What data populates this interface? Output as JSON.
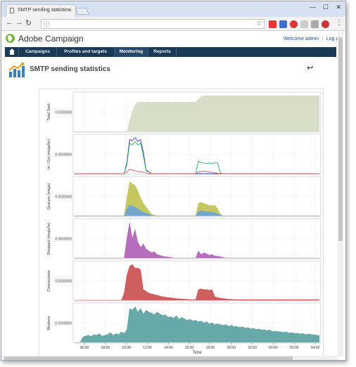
{
  "browser": {
    "tab_title": "SMTP sending statistics",
    "tab_close": "×",
    "win_minimize": "—",
    "win_maximize": "☐",
    "win_close": "✕"
  },
  "header": {
    "app_title": "Adobe Campaign",
    "welcome": "Welcome admin",
    "separator": "|",
    "logoff": "Log off"
  },
  "menu": {
    "items": [
      {
        "label": "Campaigns"
      },
      {
        "label": "Profiles and targets"
      },
      {
        "label": "Monitoring"
      },
      {
        "label": "Reports"
      }
    ]
  },
  "page": {
    "title": "SMTP sending statistics",
    "back_icon": "↩"
  },
  "chart_data": {
    "type": "area",
    "xlabel": "Time",
    "x_ticks": [
      "06:00",
      "08:00",
      "10:00",
      "12:00",
      "14:00",
      "16:00",
      "18:00",
      "20:00",
      "22:00",
      "00:00",
      "02:00",
      "04:00"
    ],
    "panels": [
      {
        "name": "Total Sent",
        "ytick": "0.0000000",
        "series": [
          {
            "color": "#d5dcc4",
            "values": [
              0,
              0,
              0,
              0,
              0,
              0,
              0,
              0,
              0,
              0,
              0,
              0,
              0,
              0,
              0,
              0,
              0,
              0,
              0,
              0,
              0.3,
              0.55,
              0.75,
              0.82,
              0.82,
              0.82,
              0.82,
              0.82,
              0.82,
              0.82,
              0.82,
              0.82,
              0.82,
              0.82,
              0.82,
              0.82,
              0.82,
              0.82,
              0.82,
              0.82,
              0.82,
              0.82,
              0.82,
              0.82,
              0.82,
              0.9,
              0.97,
              1,
              1,
              1,
              1,
              1,
              1,
              1,
              1,
              1,
              1,
              1,
              1,
              1,
              1,
              1,
              1,
              1,
              1,
              1,
              1,
              1,
              1,
              1,
              1,
              1,
              1,
              1,
              1,
              1,
              1,
              1,
              1,
              1,
              1,
              1,
              1,
              1,
              1,
              1,
              1,
              1,
              1,
              1
            ]
          }
        ]
      },
      {
        "name": "In / Out (msgs/hr)",
        "ytick": "0.0000000",
        "series": [
          {
            "color": "#3b3bd6",
            "values": [
              0,
              0,
              0,
              0,
              0,
              0,
              0,
              0,
              0,
              0,
              0,
              0,
              0,
              0,
              0,
              0,
              0,
              0,
              0,
              0.3,
              0.95,
              0.92,
              1,
              0.9,
              0.95,
              0.6,
              0.1,
              0.05,
              0,
              0,
              0,
              0,
              0,
              0,
              0,
              0,
              0,
              0,
              0,
              0,
              0,
              0,
              0,
              0,
              0,
              0,
              0,
              0,
              0,
              0,
              0,
              0,
              0,
              0,
              0,
              0,
              0,
              0,
              0,
              0,
              0,
              0,
              0,
              0,
              0,
              0,
              0,
              0,
              0,
              0,
              0,
              0,
              0,
              0,
              0,
              0,
              0,
              0,
              0,
              0,
              0,
              0,
              0,
              0,
              0,
              0,
              0,
              0,
              0,
              0
            ]
          },
          {
            "color": "#27b35a",
            "values": [
              0,
              0,
              0,
              0,
              0,
              0,
              0,
              0,
              0,
              0,
              0,
              0,
              0,
              0,
              0,
              0,
              0,
              0,
              0,
              0.25,
              0.85,
              0.8,
              0.9,
              0.8,
              0.85,
              0.5,
              0.08,
              0.04,
              0,
              0,
              0,
              0,
              0,
              0,
              0,
              0,
              0,
              0,
              0,
              0,
              0,
              0,
              0,
              0,
              0,
              0.35,
              0.3,
              0.3,
              0.28,
              0.3,
              0.28,
              0.3,
              0.3,
              0.02,
              0,
              0,
              0,
              0,
              0,
              0,
              0,
              0,
              0,
              0,
              0,
              0,
              0,
              0,
              0,
              0,
              0,
              0,
              0,
              0,
              0,
              0,
              0,
              0,
              0,
              0,
              0,
              0,
              0,
              0,
              0,
              0,
              0,
              0,
              0,
              0
            ]
          },
          {
            "color": "#e05a5a",
            "values": [
              0,
              0,
              0,
              0,
              0,
              0,
              0,
              0,
              0,
              0,
              0,
              0,
              0,
              0,
              0,
              0,
              0,
              0,
              0,
              0.05,
              0.12,
              0.1,
              0.08,
              0.06,
              0.05,
              0.04,
              0.02,
              0,
              0,
              0,
              0,
              0,
              0,
              0,
              0,
              0,
              0,
              0,
              0,
              0,
              0,
              0,
              0,
              0,
              0,
              0.05,
              0.06,
              0.07,
              0.06,
              0.05,
              0.03,
              0.02,
              0.01,
              0,
              0,
              0,
              0,
              0,
              0,
              0,
              0,
              0,
              0,
              0,
              0,
              0,
              0,
              0,
              0,
              0,
              0,
              0,
              0,
              0,
              0,
              0,
              0,
              0,
              0,
              0,
              0,
              0,
              0,
              0,
              0,
              0,
              0,
              0,
              0,
              0
            ]
          }
        ]
      },
      {
        "name": "Queues (msgs)",
        "ytick": "0.0000000",
        "series": [
          {
            "color": "#c4c45a",
            "values": [
              0,
              0,
              0,
              0,
              0,
              0,
              0,
              0,
              0,
              0,
              0,
              0,
              0,
              0,
              0,
              0,
              0,
              0,
              0,
              0.5,
              0.95,
              0.9,
              0.85,
              0.7,
              0.5,
              0.35,
              0.25,
              0.15,
              0.05,
              0.02,
              0,
              0,
              0,
              0,
              0,
              0,
              0,
              0,
              0,
              0,
              0,
              0,
              0,
              0,
              0,
              0.35,
              0.38,
              0.35,
              0.32,
              0.3,
              0.28,
              0.3,
              0.2,
              0.05,
              0,
              0,
              0,
              0,
              0,
              0,
              0,
              0,
              0,
              0,
              0,
              0,
              0,
              0,
              0,
              0,
              0,
              0,
              0,
              0,
              0,
              0,
              0,
              0,
              0,
              0,
              0,
              0,
              0,
              0,
              0,
              0,
              0,
              0,
              0,
              0
            ]
          },
          {
            "color": "#6fa7d0",
            "values": [
              0,
              0,
              0,
              0,
              0,
              0,
              0,
              0,
              0,
              0,
              0,
              0,
              0,
              0,
              0,
              0,
              0,
              0,
              0,
              0.2,
              0.3,
              0.28,
              0.25,
              0.2,
              0.15,
              0.1,
              0.08,
              0.05,
              0.02,
              0,
              0,
              0,
              0,
              0,
              0,
              0,
              0,
              0,
              0,
              0,
              0,
              0,
              0,
              0,
              0,
              0.12,
              0.14,
              0.13,
              0.12,
              0.12,
              0.1,
              0.1,
              0.06,
              0.02,
              0,
              0,
              0,
              0,
              0,
              0,
              0,
              0,
              0,
              0,
              0,
              0,
              0,
              0,
              0,
              0,
              0,
              0,
              0,
              0,
              0,
              0,
              0,
              0,
              0,
              0,
              0,
              0,
              0,
              0,
              0,
              0,
              0,
              0,
              0,
              0
            ]
          }
        ]
      },
      {
        "name": "Dropped (msgs/hr)",
        "ytick": "0.0000000",
        "series": [
          {
            "color": "#b266b8",
            "values": [
              0,
              0,
              0,
              0,
              0,
              0,
              0,
              0,
              0,
              0,
              0,
              0,
              0,
              0,
              0,
              0,
              0,
              0,
              0,
              0.55,
              1,
              0.55,
              0.8,
              0.45,
              0.3,
              0.4,
              0.25,
              0.2,
              0.15,
              0.18,
              0.1,
              0.08,
              0.05,
              0.04,
              0.03,
              0.02,
              0,
              0,
              0,
              0,
              0,
              0,
              0,
              0,
              0,
              0.2,
              0.1,
              0.15,
              0.12,
              0.08,
              0.1,
              0.06,
              0.05,
              0.04,
              0.02,
              0,
              0,
              0,
              0,
              0,
              0,
              0,
              0,
              0,
              0,
              0,
              0,
              0,
              0,
              0,
              0,
              0,
              0,
              0,
              0,
              0,
              0,
              0,
              0,
              0,
              0,
              0,
              0,
              0,
              0,
              0,
              0,
              0,
              0,
              0
            ]
          }
        ]
      },
      {
        "name": "Connections",
        "ytick": "0.0000000",
        "series": [
          {
            "color": "#cc5555",
            "values": [
              0,
              0,
              0,
              0,
              0,
              0,
              0,
              0,
              0,
              0,
              0,
              0,
              0,
              0,
              0,
              0,
              0,
              0,
              0.2,
              0.7,
              0.95,
              1,
              0.9,
              0.9,
              0.85,
              0.3,
              0.25,
              0.2,
              0.18,
              0.16,
              0.14,
              0.12,
              0.1,
              0.09,
              0.08,
              0.07,
              0.06,
              0.05,
              0.04,
              0.04,
              0.03,
              0.03,
              0.02,
              0.02,
              0.02,
              0.3,
              0.32,
              0.3,
              0.3,
              0.28,
              0.3,
              0.1,
              0.08,
              0.06,
              0.05,
              0.04,
              0.03,
              0.03,
              0.02,
              0.02,
              0.02,
              0.02,
              0.02,
              0.02,
              0.02,
              0.02,
              0.02,
              0.02,
              0.02,
              0.02,
              0.02,
              0.02,
              0.02,
              0.02,
              0.02,
              0.02,
              0.02,
              0.02,
              0.02,
              0.02,
              0.02,
              0.02,
              0.02,
              0.02,
              0.02,
              0.02,
              0.02,
              0.02,
              0.02,
              0.02
            ]
          }
        ]
      },
      {
        "name": "Workers",
        "ytick": "0.0000000",
        "series": [
          {
            "color": "#5fa3a3",
            "values": [
              0,
              0,
              0,
              0.15,
              0.18,
              0.2,
              0.17,
              0.22,
              0.2,
              0.25,
              0.18,
              0.2,
              0.22,
              0.28,
              0.2,
              0.25,
              0.22,
              0.3,
              0.25,
              0.35,
              0.95,
              0.9,
              1,
              0.85,
              0.95,
              0.8,
              0.9,
              0.85,
              0.82,
              0.78,
              0.85,
              0.8,
              0.75,
              0.78,
              0.7,
              0.72,
              0.68,
              0.75,
              0.65,
              0.7,
              0.66,
              0.62,
              0.65,
              0.6,
              0.62,
              0.58,
              0.6,
              0.55,
              0.58,
              0.52,
              0.55,
              0.5,
              0.52,
              0.5,
              0.48,
              0.5,
              0.45,
              0.48,
              0.44,
              0.45,
              0.42,
              0.44,
              0.4,
              0.42,
              0.38,
              0.4,
              0.36,
              0.38,
              0.35,
              0.36,
              0.33,
              0.35,
              0.3,
              0.32,
              0.3,
              0.3,
              0.28,
              0.3,
              0.26,
              0.28,
              0.25,
              0.26,
              0.24,
              0.25,
              0.22,
              0.24,
              0.22,
              0.22,
              0.2,
              0.2
            ]
          }
        ]
      }
    ]
  }
}
